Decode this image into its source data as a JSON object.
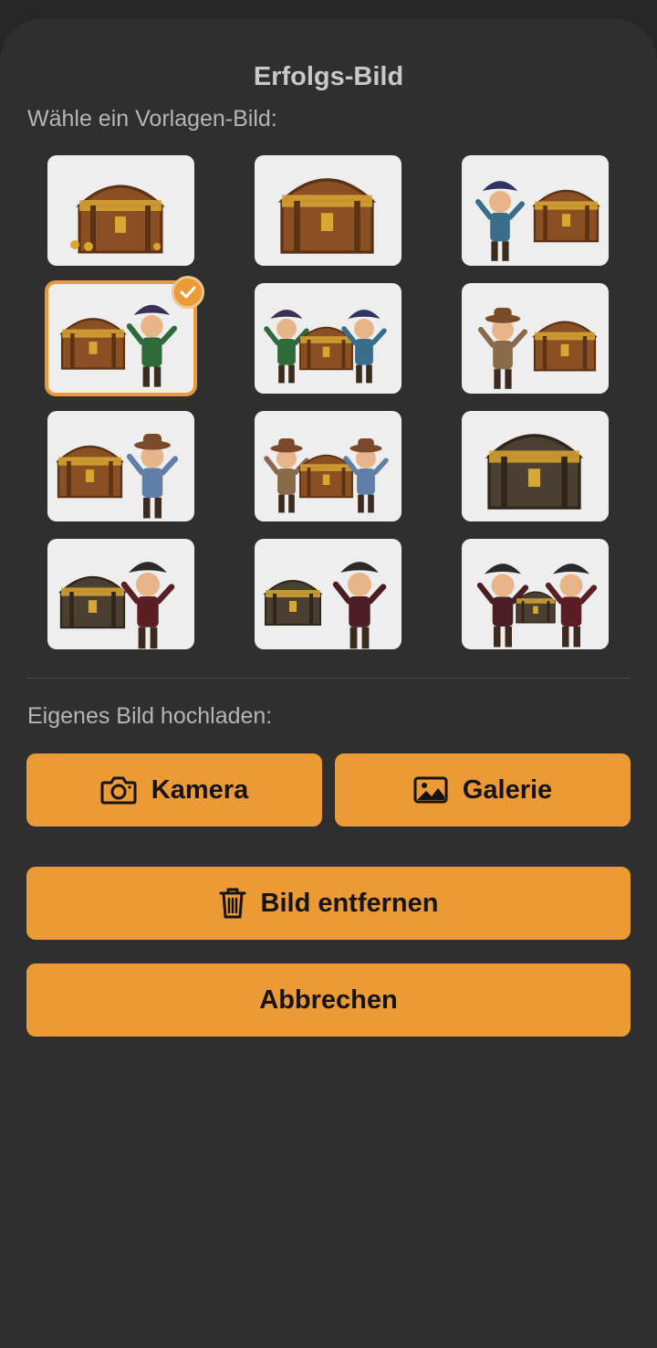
{
  "sheet": {
    "title": "Erfolgs-Bild",
    "template_label": "Wähle ein Vorlagen-Bild:",
    "upload_label": "Eigenes Bild hochladen:"
  },
  "templates": [
    {
      "name": "treasure-chest-gold",
      "selected": false
    },
    {
      "name": "treasure-chest-jewels",
      "selected": false
    },
    {
      "name": "pirate-boy-chest",
      "selected": false
    },
    {
      "name": "pirate-girl-chest",
      "selected": true
    },
    {
      "name": "pirate-kids-chest",
      "selected": false
    },
    {
      "name": "cowboy-boy-chest",
      "selected": false
    },
    {
      "name": "cowgirl-chest",
      "selected": false
    },
    {
      "name": "cowboy-kids-chest",
      "selected": false
    },
    {
      "name": "dark-treasure-chest",
      "selected": false
    },
    {
      "name": "pirate-man-chest",
      "selected": false
    },
    {
      "name": "pirate-woman-chest",
      "selected": false
    },
    {
      "name": "pirate-couple-chest",
      "selected": false
    }
  ],
  "buttons": {
    "camera": "Kamera",
    "gallery": "Galerie",
    "remove": "Bild entfernen",
    "cancel": "Abbrechen"
  },
  "icons": {
    "camera": "camera-icon",
    "gallery": "image-icon",
    "remove": "trash-icon",
    "selected": "checkmark-icon"
  },
  "colors": {
    "accent": "#ec9a36",
    "sheet_bg": "#2f2f2f",
    "tile_bg": "#eeeeee"
  }
}
